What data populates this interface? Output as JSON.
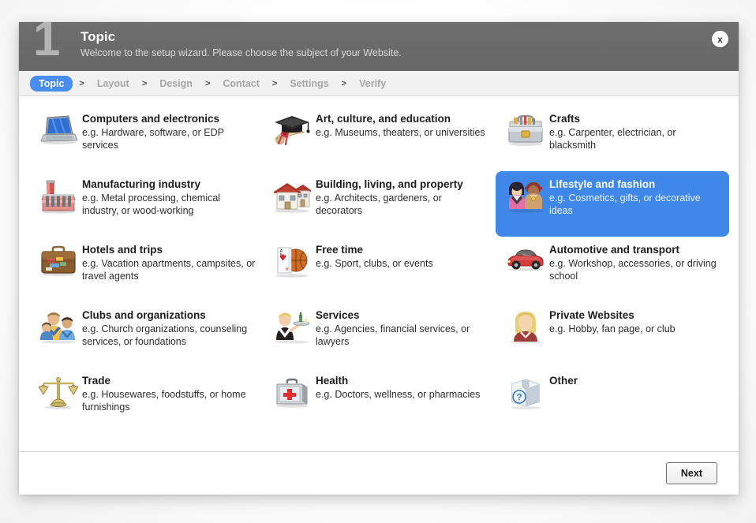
{
  "window": {
    "step_number": "1",
    "title": "Topic",
    "subtitle": "Welcome to the setup wizard. Please choose the subject of your Website.",
    "close_label": "x",
    "close_icon": "close-icon"
  },
  "colors": {
    "titlebar_bg": "#6a6a6a",
    "accent_blue": "#3f87e8",
    "breadcrumb_active_bg": "#4a8df0",
    "breadcrumb_inactive_text": "#a6a6a6",
    "step_number_color": "#b4b4b4",
    "page_bg": "#ffffff"
  },
  "breadcrumb": {
    "separator": ">",
    "steps": [
      {
        "label": "Topic",
        "active": true
      },
      {
        "label": "Layout",
        "active": false
      },
      {
        "label": "Design",
        "active": false
      },
      {
        "label": "Contact",
        "active": false
      },
      {
        "label": "Settings",
        "active": false
      },
      {
        "label": "Verify",
        "active": false
      }
    ]
  },
  "topics": [
    {
      "title": "Computers and electronics",
      "desc": "e.g. Hardware, software, or EDP services",
      "icon": "laptop-icon",
      "selected": false
    },
    {
      "title": "Art, culture, and education",
      "desc": "e.g. Museums, theaters, or universities",
      "icon": "graduation-cap-diploma-icon",
      "selected": false
    },
    {
      "title": "Crafts",
      "desc": "e.g. Carpenter, electrician, or blacksmith",
      "icon": "toolbox-icon",
      "selected": false
    },
    {
      "title": "Manufacturing industry",
      "desc": "e.g. Metal processing, chemical industry, or wood-working",
      "icon": "factory-icon",
      "selected": false
    },
    {
      "title": "Building, living, and property",
      "desc": "e.g. Architects, gardeners, or decorators",
      "icon": "houses-icon",
      "selected": false
    },
    {
      "title": "Lifestyle and fashion",
      "desc": "e.g. Cosmetics, gifts, or decorative ideas",
      "icon": "two-people-fashion-icon",
      "selected": true
    },
    {
      "title": "Hotels and trips",
      "desc": "e.g. Vacation apartments, campsites, or travel agents",
      "icon": "suitcase-icon",
      "selected": false
    },
    {
      "title": "Free time",
      "desc": "e.g. Sport, clubs, or events",
      "icon": "playing-card-basketball-icon",
      "selected": false
    },
    {
      "title": "Automotive and transport",
      "desc": "e.g. Workshop, accessories, or driving school",
      "icon": "car-icon",
      "selected": false
    },
    {
      "title": "Clubs and organizations",
      "desc": "e.g. Church organizations, counseling services, or foundations",
      "icon": "group-of-people-icon",
      "selected": false
    },
    {
      "title": "Services",
      "desc": "e.g. Agencies, financial services, or lawyers",
      "icon": "waiter-icon",
      "selected": false
    },
    {
      "title": "Private Websites",
      "desc": "e.g. Hobby, fan page, or club",
      "icon": "woman-portrait-icon",
      "selected": false
    },
    {
      "title": "Trade",
      "desc": "e.g. Housewares, foodstuffs, or home furnishings",
      "icon": "scales-balance-icon",
      "selected": false
    },
    {
      "title": "Health",
      "desc": "e.g. Doctors, wellness, or pharmacies",
      "icon": "first-aid-kit-icon",
      "selected": false
    },
    {
      "title": "Other",
      "desc": "",
      "icon": "question-box-icon",
      "selected": false
    }
  ],
  "footer": {
    "next_label": "Next"
  }
}
